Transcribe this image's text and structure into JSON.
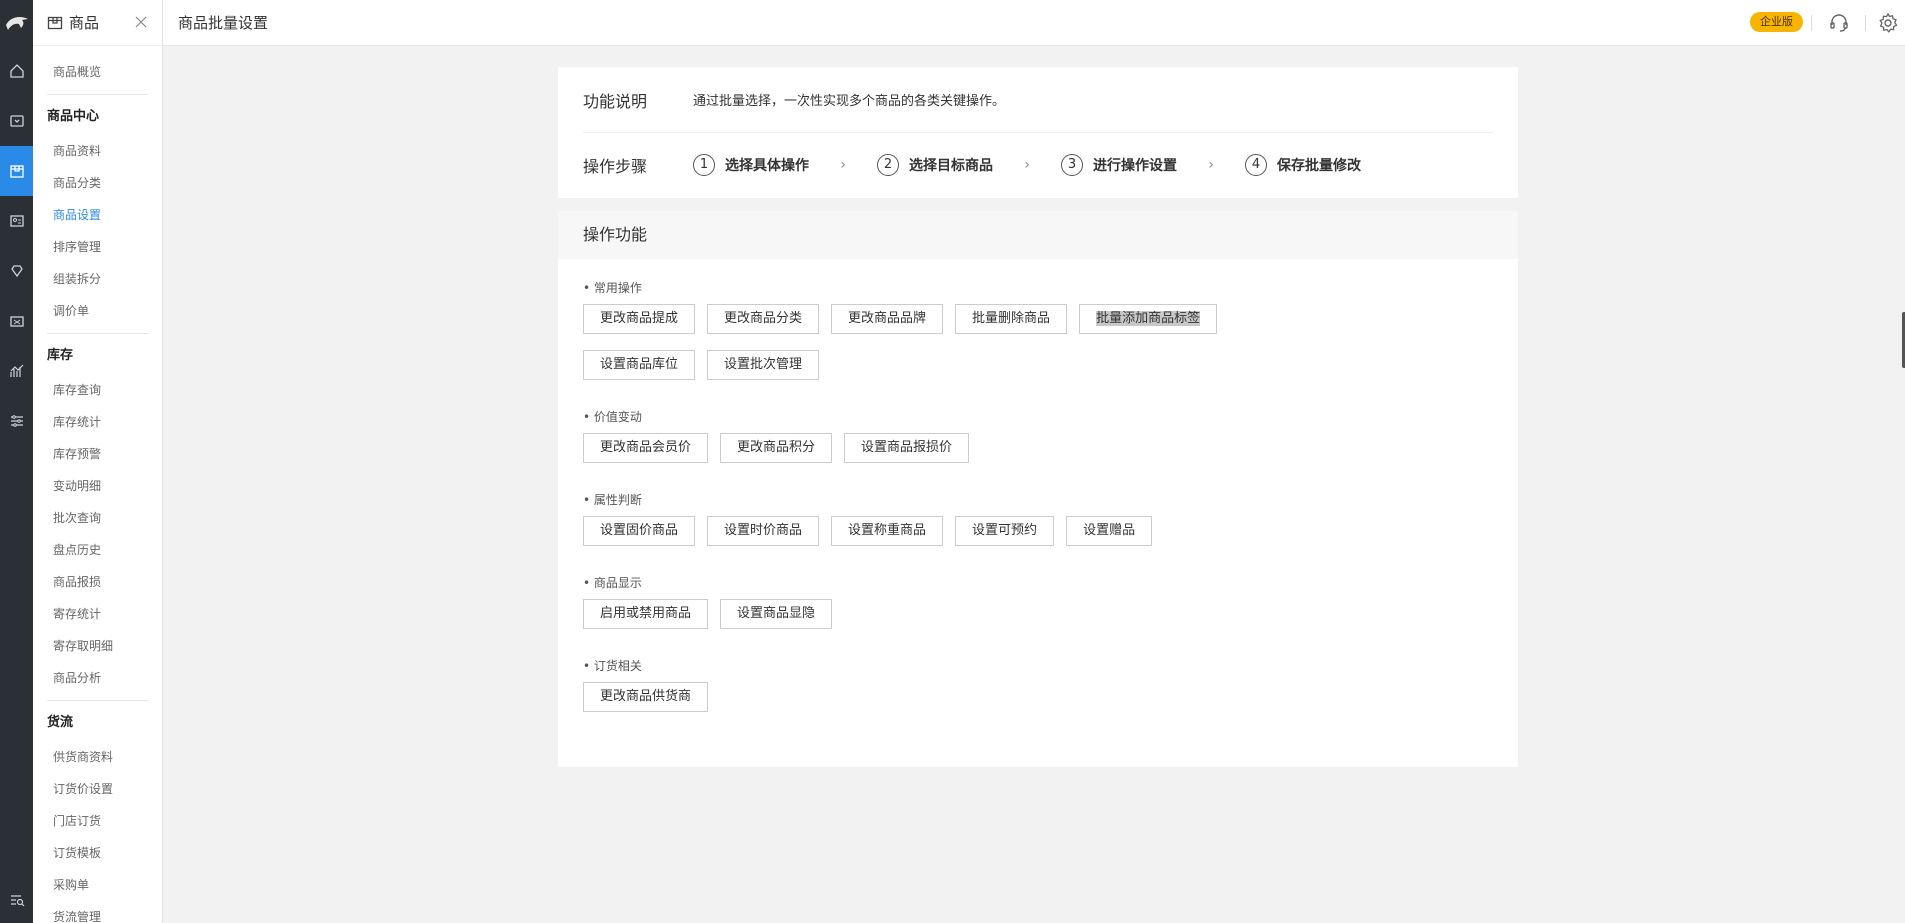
{
  "sidebar": {
    "header_title": "商品",
    "groups": [
      {
        "title": "",
        "items": [
          {
            "label": "商品概览",
            "active": false
          }
        ]
      },
      {
        "title": "商品中心",
        "items": [
          {
            "label": "商品资料",
            "active": false
          },
          {
            "label": "商品分类",
            "active": false
          },
          {
            "label": "商品设置",
            "active": true
          },
          {
            "label": "排序管理",
            "active": false
          },
          {
            "label": "组装拆分",
            "active": false
          },
          {
            "label": "调价单",
            "active": false
          }
        ]
      },
      {
        "title": "库存",
        "items": [
          {
            "label": "库存查询",
            "active": false
          },
          {
            "label": "库存统计",
            "active": false
          },
          {
            "label": "库存预警",
            "active": false
          },
          {
            "label": "变动明细",
            "active": false
          },
          {
            "label": "批次查询",
            "active": false
          },
          {
            "label": "盘点历史",
            "active": false
          },
          {
            "label": "商品报损",
            "active": false
          },
          {
            "label": "寄存统计",
            "active": false
          },
          {
            "label": "寄存取明细",
            "active": false
          },
          {
            "label": "商品分析",
            "active": false
          }
        ]
      },
      {
        "title": "货流",
        "items": [
          {
            "label": "供货商资料",
            "active": false
          },
          {
            "label": "订货价设置",
            "active": false
          },
          {
            "label": "门店订货",
            "active": false
          },
          {
            "label": "订货模板",
            "active": false
          },
          {
            "label": "采购单",
            "active": false
          },
          {
            "label": "货流管理",
            "active": false
          }
        ]
      }
    ]
  },
  "topbar": {
    "page_title": "商品批量设置",
    "edition_badge": "企业版"
  },
  "intro": {
    "label": "功能说明",
    "text": "通过批量选择，一次性实现多个商品的各类关键操作。"
  },
  "steps": {
    "label": "操作步骤",
    "items": [
      {
        "num": "1",
        "label": "选择具体操作"
      },
      {
        "num": "2",
        "label": "选择目标商品"
      },
      {
        "num": "3",
        "label": "进行操作设置"
      },
      {
        "num": "4",
        "label": "保存批量修改"
      }
    ],
    "arrow": "›"
  },
  "functions": {
    "title": "操作功能",
    "sections": [
      {
        "title": "• 常用操作",
        "buttons": [
          "更改商品提成",
          "更改商品分类",
          "更改商品品牌",
          "批量删除商品",
          "批量添加商品标签",
          "设置商品库位",
          "设置批次管理"
        ]
      },
      {
        "title": "• 价值变动",
        "buttons": [
          "更改商品会员价",
          "更改商品积分",
          "设置商品报损价"
        ]
      },
      {
        "title": "• 属性判断",
        "buttons": [
          "设置固价商品",
          "设置时价商品",
          "设置称重商品",
          "设置可预约",
          "设置赠品"
        ]
      },
      {
        "title": "• 商品显示",
        "buttons": [
          "启用或禁用商品",
          "设置商品显隐"
        ]
      },
      {
        "title": "• 订货相关",
        "buttons": [
          "更改商品供货商"
        ]
      }
    ]
  },
  "colors": {
    "rail_bg": "#2b2f36",
    "accent": "#2a8ae8",
    "badge": "#f7b500"
  }
}
